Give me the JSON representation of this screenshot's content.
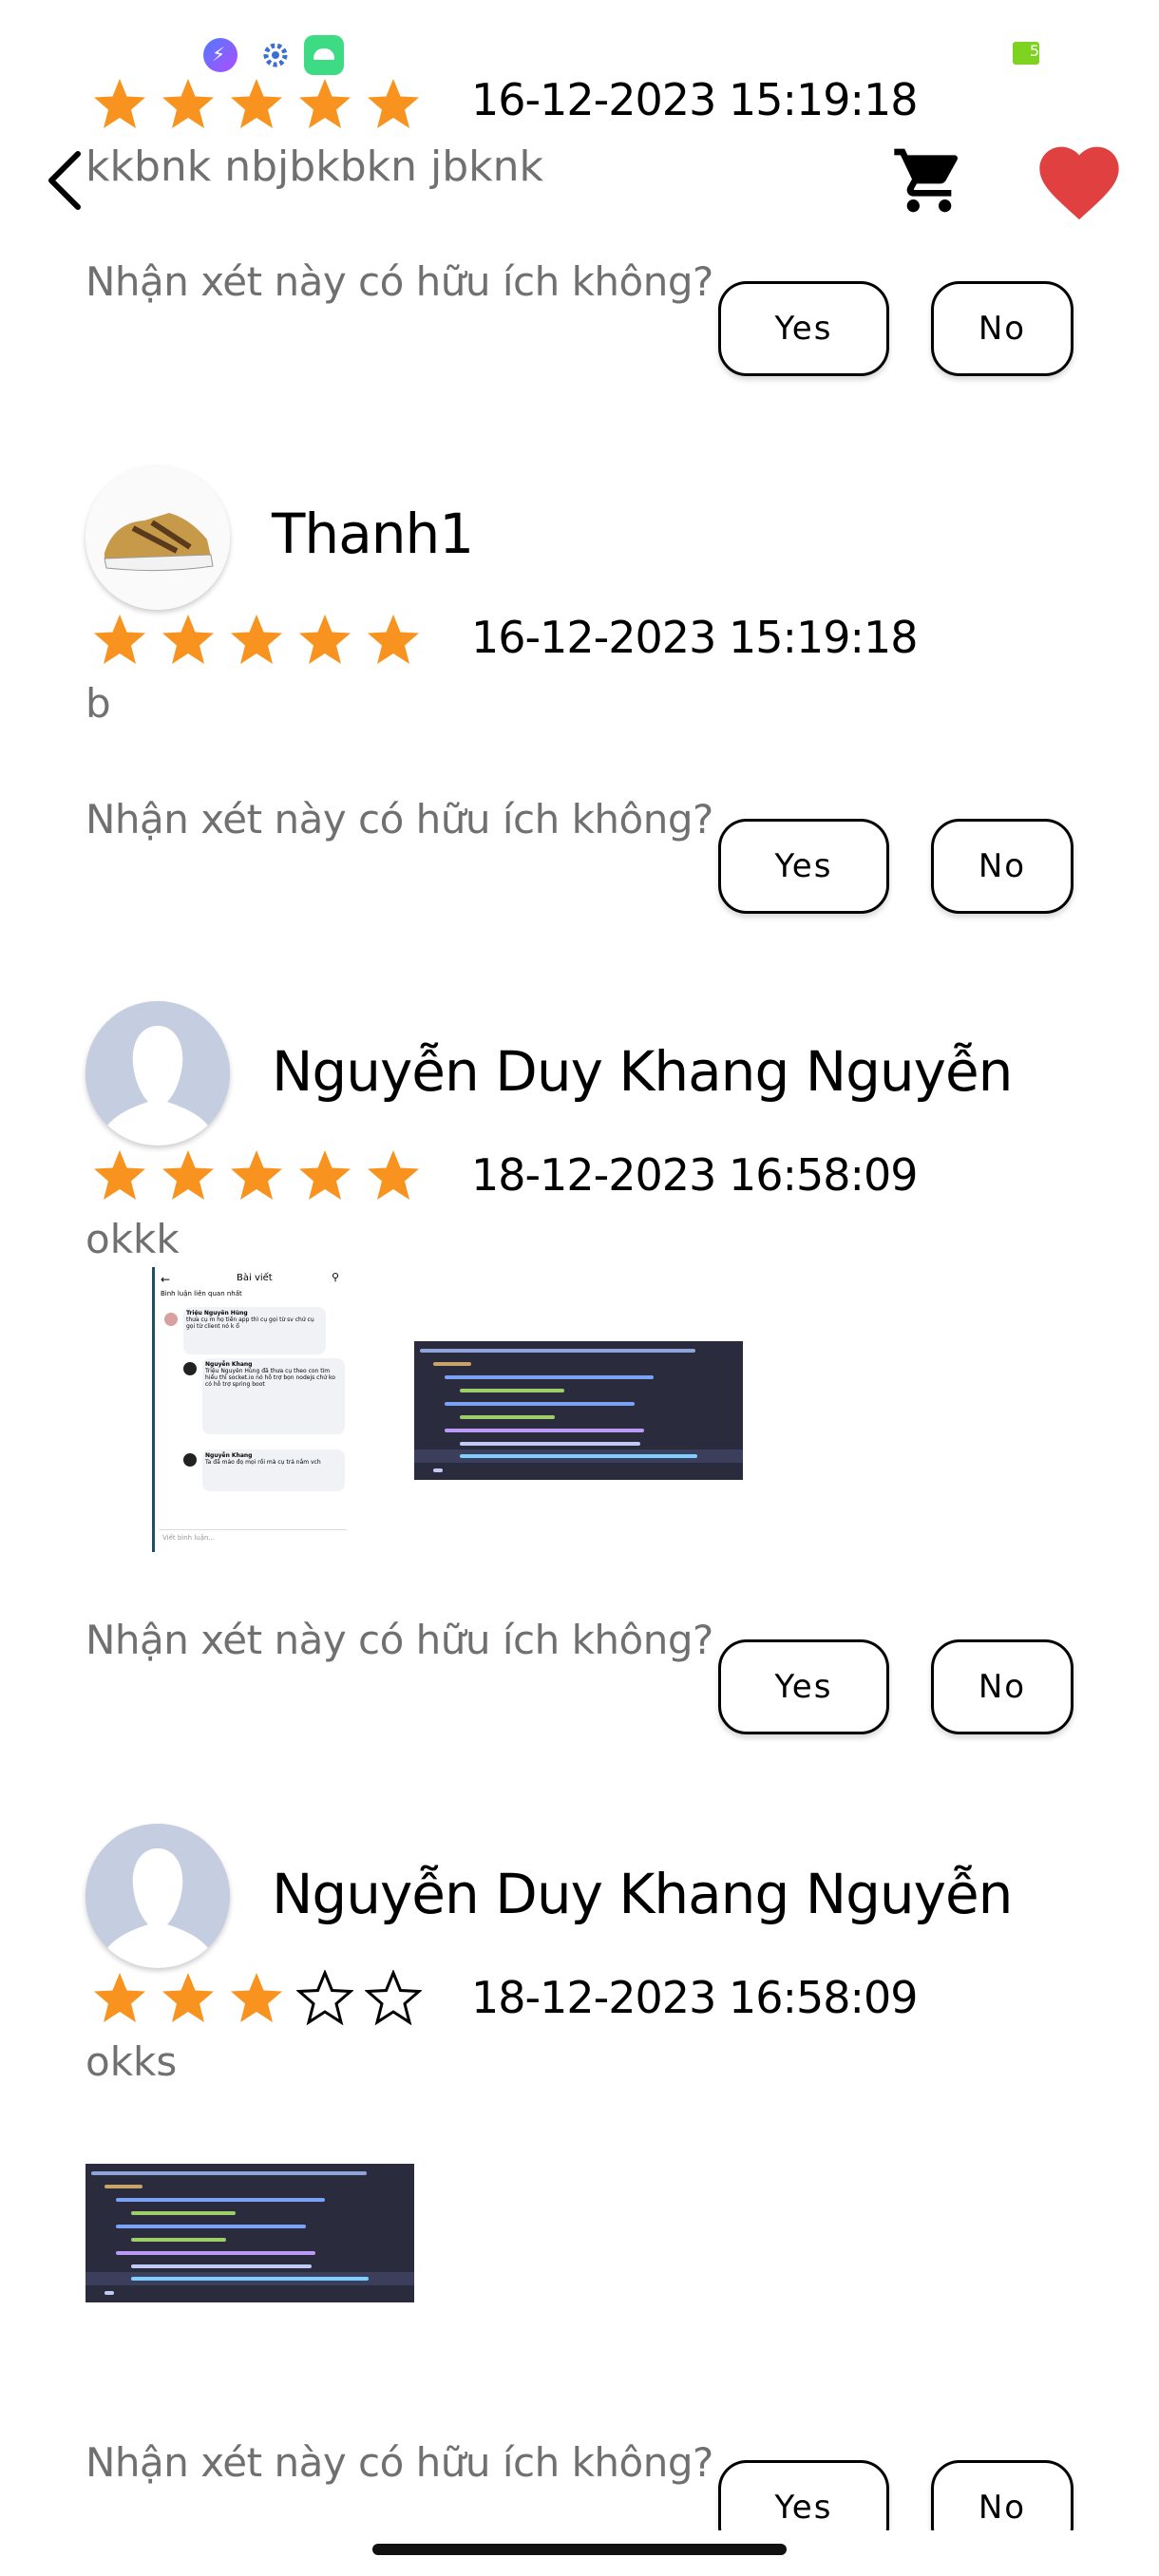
{
  "header": {
    "title": "kkbnk nbjbkbkn jbknk",
    "back_icon": "chevron-left-icon",
    "cart_icon": "cart-icon",
    "favorite_icon": "heart-icon",
    "favorite_color": "#e04040"
  },
  "status_bar": {
    "battery_text": "5"
  },
  "colors": {
    "star_filled": "#f7931e",
    "muted_text": "#707070"
  },
  "helpful_question": "Nhận xét này có hữu ích không?",
  "yes_label": "Yes",
  "no_label": "No",
  "reviews": [
    {
      "user": "",
      "rating": 5,
      "date": "16-12-2023 15:19:18",
      "comment": "",
      "avatar": "none",
      "images": []
    },
    {
      "user": "Thanh1",
      "rating": 5,
      "date": "16-12-2023 15:19:18",
      "comment": "b",
      "avatar": "shoe-photo",
      "images": []
    },
    {
      "user": "Nguyễn Duy Khang Nguyễn",
      "rating": 5,
      "date": "18-12-2023 16:58:09",
      "comment": "okkk",
      "avatar": "default-person",
      "images": [
        "social-post-screenshot",
        "code-screenshot"
      ],
      "thumb_post": {
        "title": "Bài viết",
        "filter": "Bình luận liên quan nhất",
        "comments": [
          {
            "author": "Triệu Nguyên Hùng",
            "text": "thưa cụ m họ tiền app thì cụ gọi từ sv chứ cụ gọi từ client nó k ổ"
          },
          {
            "author": "Nguyễn Khang",
            "text": "Triệu Nguyên Hùng đã thưa cụ theo con tìm hiểu thì socket.io nó hỗ trợ bọn nodejs chứ ko có hỗ trợ spring boot"
          },
          {
            "author": "Nguyễn Khang",
            "text": "Ta đã mảo đọ mọi rồi mà cụ trả nắm vch"
          }
        ],
        "input_placeholder": "Viết bình luận..."
      }
    },
    {
      "user": "Nguyễn Duy Khang Nguyễn",
      "rating": 3,
      "date": "18-12-2023 16:58:09",
      "comment": "okks",
      "avatar": "default-person",
      "images": [
        "code-screenshot"
      ]
    }
  ]
}
